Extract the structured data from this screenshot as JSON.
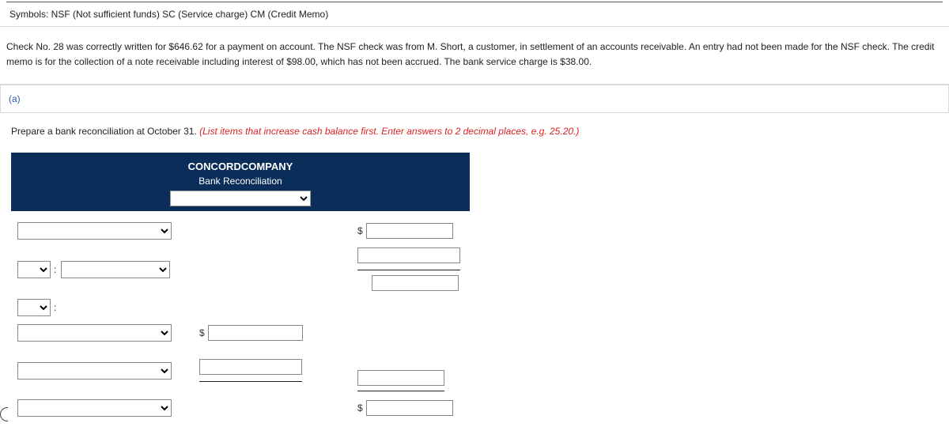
{
  "symbols_line": "Symbols: NSF (Not sufficient funds) SC (Service charge) CM (Credit Memo)",
  "problem_text": "Check No. 28 was correctly written for $646.62 for a payment on account. The NSF check was from M. Short, a customer, in settlement of an accounts receivable. An entry had not been made for the NSF check. The credit memo is for the collection of a note receivable including interest of $98.00, which has not been accrued. The bank service charge is $38.00.",
  "part_label": "(a)",
  "instruction_plain": "Prepare a bank reconciliation at October 31. ",
  "instruction_italic": "(List items that increase cash balance first. Enter answers to 2 decimal places, e.g. 25.20.)",
  "company_name": "CONCORDCOMPANY",
  "doc_title": "Bank Reconciliation",
  "colon": ":",
  "dollar": "$"
}
